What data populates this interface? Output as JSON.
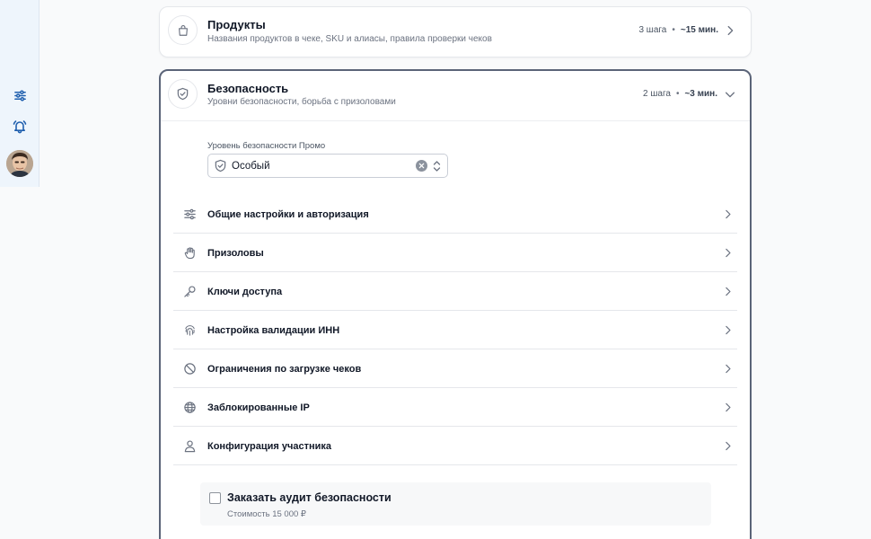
{
  "sidebar": {
    "icons": [
      "filters-icon",
      "bell-icon"
    ],
    "avatar": "user-avatar"
  },
  "products": {
    "title": "Продукты",
    "subtitle": "Названия продуктов в чеке, SKU и алиасы, правила проверки чеков",
    "steps": "3 шага",
    "time": "~15 мин.",
    "icon": "shopping-bag-icon",
    "expanded": false
  },
  "security": {
    "title": "Безопасность",
    "subtitle": "Уровни безопасности, борьба с призоловами",
    "steps": "2 шага",
    "time": "~3 мин.",
    "icon": "shield-check-icon",
    "expanded": true,
    "level_label": "Уровень безопасности Промо",
    "level_value": "Особый",
    "items": [
      {
        "label": "Общие настройки и авторизация",
        "icon": "sliders-icon"
      },
      {
        "label": "Призоловы",
        "icon": "hand-icon"
      },
      {
        "label": "Ключи доступа",
        "icon": "key-icon"
      },
      {
        "label": "Настройка валидации ИНН",
        "icon": "fingerprint-icon"
      },
      {
        "label": "Ограничения по загрузке чеков",
        "icon": "ban-icon"
      },
      {
        "label": "Заблокированные IP",
        "icon": "globe-icon"
      },
      {
        "label": "Конфигурация участника",
        "icon": "user-icon"
      }
    ],
    "audit": {
      "label": "Заказать аудит безопасности",
      "price": "Стоимость 15 000 ₽",
      "checked": false
    }
  },
  "colors": {
    "rail_bg": "#eef5fc",
    "rail_icon": "#1f5fae",
    "active_border": "#5b6478",
    "muted_text": "#6b7280"
  }
}
